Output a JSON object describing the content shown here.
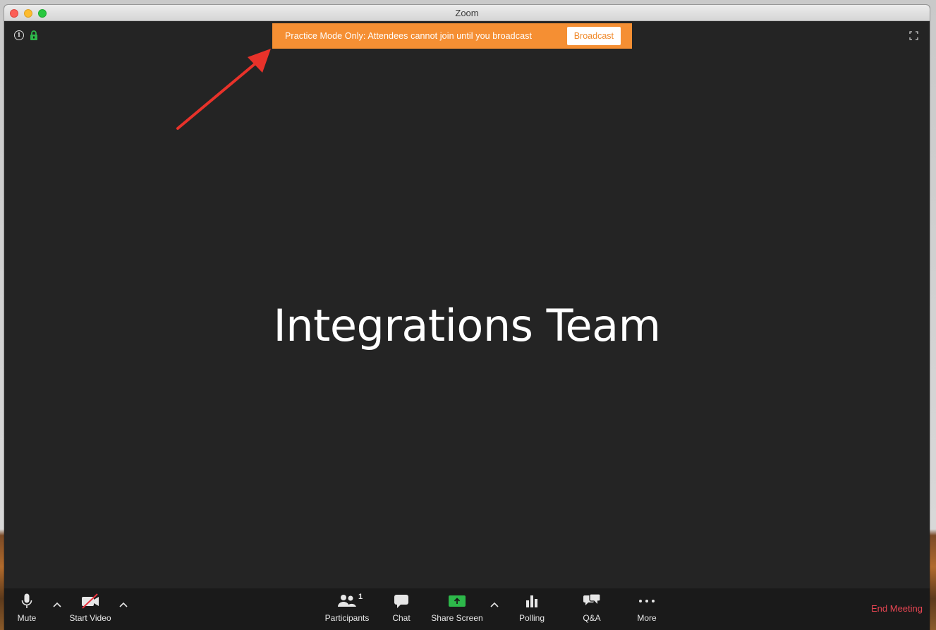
{
  "window": {
    "title": "Zoom"
  },
  "banner": {
    "message": "Practice Mode Only: Attendees cannot join until you broadcast",
    "button_label": "Broadcast",
    "color": "#f58f33"
  },
  "meeting": {
    "name": "Integrations Team"
  },
  "toolbar": {
    "mute_label": "Mute",
    "start_video_label": "Start Video",
    "participants_label": "Participants",
    "participants_count": "1",
    "chat_label": "Chat",
    "share_screen_label": "Share Screen",
    "polling_label": "Polling",
    "qa_label": "Q&A",
    "more_label": "More",
    "end_meeting_label": "End Meeting"
  },
  "colors": {
    "share_green": "#2db84a",
    "end_red": "#e74552",
    "annotation_arrow": "#e8322a"
  }
}
